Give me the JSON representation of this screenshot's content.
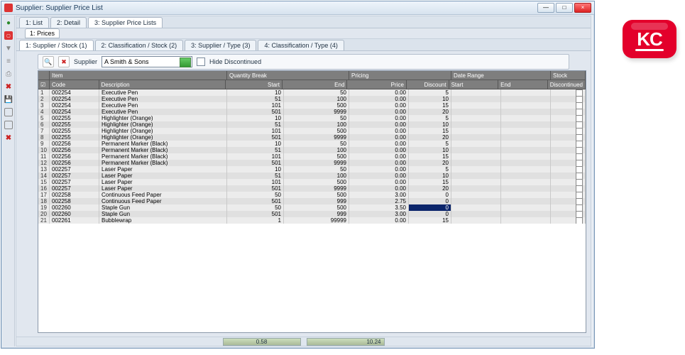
{
  "window": {
    "title": "Supplier: Supplier Price List",
    "min": "—",
    "max": "□",
    "close": "×"
  },
  "mainTabs": [
    {
      "label": "1: List"
    },
    {
      "label": "2: Detail"
    },
    {
      "label": "3: Supplier Price Lists"
    }
  ],
  "subTab": "1: Prices",
  "viewTabs": [
    {
      "label": "1: Supplier / Stock (1)"
    },
    {
      "label": "2: Classification / Stock (2)"
    },
    {
      "label": "3: Supplier / Type (3)"
    },
    {
      "label": "4: Classification / Type (4)"
    }
  ],
  "filter": {
    "supplierLabel": "Supplier",
    "supplierValue": "A Smith & Sons",
    "hideDisc": "Hide Discontinued"
  },
  "groupHead": {
    "item": "Item",
    "qty": "Quantity Break",
    "price": "Pricing",
    "date": "Date Range",
    "stock": "Stock"
  },
  "colHead": {
    "code": "Code",
    "desc": "Description",
    "start": "Start",
    "end": "End",
    "price": "Price",
    "disc": "Discount",
    "dstart": "Start",
    "dend": "End",
    "dc": "Discontinued"
  },
  "rows": [
    {
      "n": "1",
      "code": "002254",
      "desc": "Executive Pen",
      "s": "10",
      "e": "50",
      "p": "0.00",
      "d": "5"
    },
    {
      "n": "2",
      "code": "002254",
      "desc": "Executive Pen",
      "s": "51",
      "e": "100",
      "p": "0.00",
      "d": "10"
    },
    {
      "n": "3",
      "code": "002254",
      "desc": "Executive Pen",
      "s": "101",
      "e": "500",
      "p": "0.00",
      "d": "15"
    },
    {
      "n": "4",
      "code": "002254",
      "desc": "Executive Pen",
      "s": "501",
      "e": "9999",
      "p": "0.00",
      "d": "20"
    },
    {
      "n": "5",
      "code": "002255",
      "desc": "Highlighter (Orange)",
      "s": "10",
      "e": "50",
      "p": "0.00",
      "d": "5"
    },
    {
      "n": "6",
      "code": "002255",
      "desc": "Highlighter (Orange)",
      "s": "51",
      "e": "100",
      "p": "0.00",
      "d": "10"
    },
    {
      "n": "7",
      "code": "002255",
      "desc": "Highlighter (Orange)",
      "s": "101",
      "e": "500",
      "p": "0.00",
      "d": "15"
    },
    {
      "n": "8",
      "code": "002255",
      "desc": "Highlighter (Orange)",
      "s": "501",
      "e": "9999",
      "p": "0.00",
      "d": "20"
    },
    {
      "n": "9",
      "code": "002256",
      "desc": "Permanent Marker (Black)",
      "s": "10",
      "e": "50",
      "p": "0.00",
      "d": "5"
    },
    {
      "n": "10",
      "code": "002256",
      "desc": "Permanent Marker (Black)",
      "s": "51",
      "e": "100",
      "p": "0.00",
      "d": "10"
    },
    {
      "n": "11",
      "code": "002256",
      "desc": "Permanent Marker (Black)",
      "s": "101",
      "e": "500",
      "p": "0.00",
      "d": "15"
    },
    {
      "n": "12",
      "code": "002256",
      "desc": "Permanent Marker (Black)",
      "s": "501",
      "e": "9999",
      "p": "0.00",
      "d": "20"
    },
    {
      "n": "13",
      "code": "002257",
      "desc": "Laser Paper",
      "s": "10",
      "e": "50",
      "p": "0.00",
      "d": "5"
    },
    {
      "n": "14",
      "code": "002257",
      "desc": "Laser Paper",
      "s": "51",
      "e": "100",
      "p": "0.00",
      "d": "10"
    },
    {
      "n": "15",
      "code": "002257",
      "desc": "Laser Paper",
      "s": "101",
      "e": "500",
      "p": "0.00",
      "d": "15"
    },
    {
      "n": "16",
      "code": "002257",
      "desc": "Laser Paper",
      "s": "501",
      "e": "9999",
      "p": "0.00",
      "d": "20"
    },
    {
      "n": "17",
      "code": "002258",
      "desc": "Continuous Feed Paper",
      "s": "50",
      "e": "500",
      "p": "3.00",
      "d": "0"
    },
    {
      "n": "18",
      "code": "002258",
      "desc": "Continuous Feed Paper",
      "s": "501",
      "e": "999",
      "p": "2.75",
      "d": "0"
    },
    {
      "n": "19",
      "code": "002260",
      "desc": "Staple Gun",
      "s": "50",
      "e": "500",
      "p": "3.50",
      "d": "0",
      "sel": true
    },
    {
      "n": "20",
      "code": "002260",
      "desc": "Staple Gun",
      "s": "501",
      "e": "999",
      "p": "3.00",
      "d": "0"
    },
    {
      "n": "21",
      "code": "002261",
      "desc": "Bubblewrap",
      "s": "1",
      "e": "99999",
      "p": "0.00",
      "d": "15"
    }
  ],
  "status": {
    "left": "0.58",
    "right": "10.24"
  },
  "brand": "KC"
}
